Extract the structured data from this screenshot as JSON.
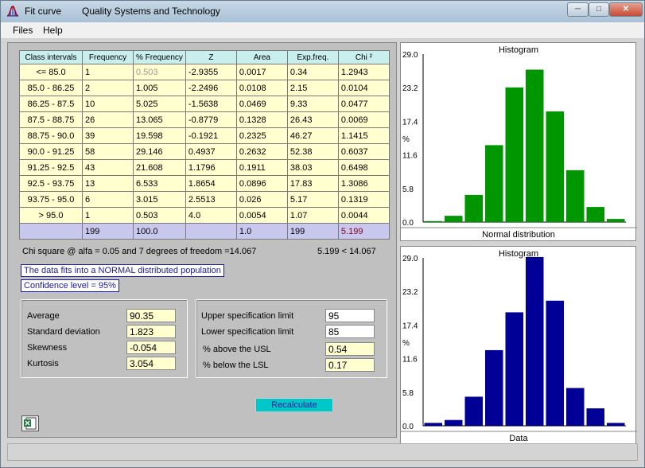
{
  "window": {
    "app_title": "Fit curve",
    "company": "Quality Systems and Technology",
    "icon": "bell-curve-icon"
  },
  "menu": [
    "Files",
    "Help"
  ],
  "table": {
    "headers": [
      "Class intervals",
      "Frequency",
      "% Frequency",
      "Z",
      "Area",
      "Exp.freq.",
      "Chi ²"
    ],
    "rows": [
      [
        "<= 85.0",
        "1",
        "0.503",
        "-2.9355",
        "0.0017",
        "0.34",
        "1.2943"
      ],
      [
        "85.0 - 86.25",
        "2",
        "1.005",
        "-2.2496",
        "0.0108",
        "2.15",
        "0.0104"
      ],
      [
        "86.25 - 87.5",
        "10",
        "5.025",
        "-1.5638",
        "0.0469",
        "9.33",
        "0.0477"
      ],
      [
        "87.5 - 88.75",
        "26",
        "13.065",
        "-0.8779",
        "0.1328",
        "26.43",
        "0.0069"
      ],
      [
        "88.75 - 90.0",
        "39",
        "19.598",
        "-0.1921",
        "0.2325",
        "46.27",
        "1.1415"
      ],
      [
        "90.0 - 91.25",
        "58",
        "29.146",
        "0.4937",
        "0.2632",
        "52.38",
        "0.6037"
      ],
      [
        "91.25 - 92.5",
        "43",
        "21.608",
        "1.1796",
        "0.1911",
        "38.03",
        "0.6498"
      ],
      [
        "92.5 - 93.75",
        "13",
        "6.533",
        "1.8654",
        "0.0896",
        "17.83",
        "1.3086"
      ],
      [
        "93.75 - 95.0",
        "6",
        "3.015",
        "2.5513",
        "0.026",
        "5.17",
        "0.1319"
      ],
      [
        "> 95.0",
        "1",
        "0.503",
        "4.0",
        "0.0054",
        "1.07",
        "0.0044"
      ]
    ],
    "totals": [
      "",
      "199",
      "100.0",
      "",
      "1.0",
      "199",
      "5.199"
    ]
  },
  "chi_square_text": "Chi square @ alfa = 0.05 and 7 degrees of freedom =14.067",
  "chi_compare": "5.199 < 14.067",
  "fit_message": "The data fits into a NORMAL distributed population",
  "confidence": "Confidence level = 95%",
  "stats": {
    "average_label": "Average",
    "average": "90.35",
    "std_label": "Standard deviation",
    "std": "1.823",
    "skew_label": "Skewness",
    "skew": "-0.054",
    "kurt_label": "Kurtosis",
    "kurt": "3.054"
  },
  "spec": {
    "usl_label": "Upper specification limit",
    "usl": "95",
    "lsl_label": "Lower specification limit",
    "lsl": "85",
    "above_label": "% above the USL",
    "above": "0.54",
    "below_label": "% below the LSL",
    "below": "0.17"
  },
  "recalculate_label": "Recalculate",
  "chart_data": [
    {
      "type": "bar",
      "title": "Histogram",
      "xlabel": "Normal distribution",
      "ylabel": "%",
      "ylim": [
        0,
        29.0
      ],
      "yticks": [
        "29.0",
        "23.2",
        "17.4",
        "11.6",
        "5.8",
        "0.0"
      ],
      "values": [
        0.17,
        1.08,
        4.69,
        13.28,
        23.25,
        26.32,
        19.11,
        8.96,
        2.6,
        0.54
      ],
      "color": "#009600"
    },
    {
      "type": "bar",
      "title": "Histogram",
      "xlabel": "Data",
      "ylabel": "%",
      "ylim": [
        0,
        29.0
      ],
      "yticks": [
        "29.0",
        "23.2",
        "17.4",
        "11.6",
        "5.8",
        "0.0"
      ],
      "values": [
        0.503,
        1.005,
        5.025,
        13.065,
        19.598,
        29.146,
        21.608,
        6.533,
        3.015,
        0.503
      ],
      "color": "#000096"
    }
  ]
}
